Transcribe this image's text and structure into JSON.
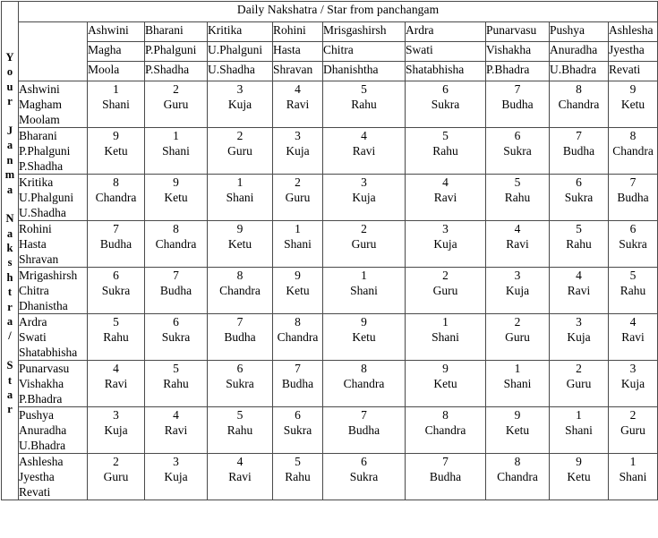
{
  "title": "Daily Nakshatra / Star from panchangam",
  "side_label": {
    "text": "Your Janma Nakshtra / Star",
    "letters": [
      "Y",
      "o",
      "u",
      "r",
      " ",
      "J",
      "a",
      "n",
      "m",
      "a",
      " ",
      "N",
      "a",
      "k",
      "s",
      "h",
      "t",
      "r",
      "a",
      "/",
      " ",
      "S",
      "t",
      "a",
      "r"
    ]
  },
  "column_headers": [
    {
      "line1": "Ashwini",
      "line2": "Magha",
      "line3": "Moola"
    },
    {
      "line1": "Bharani",
      "line2": "P.Phalguni",
      "line3": "P.Shadha"
    },
    {
      "line1": "Kritika",
      "line2": "U.Phalguni",
      "line3": "U.Shadha"
    },
    {
      "line1": "Rohini",
      "line2": "Hasta",
      "line3": "Shravan"
    },
    {
      "line1": "Mrisgashirsh",
      "line2": "Chitra",
      "line3": "Dhanishtha"
    },
    {
      "line1": "Ardra",
      "line2": "Swati",
      "line3": "Shatabhisha"
    },
    {
      "line1": "Punarvasu",
      "line2": "Vishakha",
      "line3": "P.Bhadra"
    },
    {
      "line1": "Pushya",
      "line2": "Anuradha",
      "line3": "U.Bhadra"
    },
    {
      "line1": "Ashlesha",
      "line2": "Jyestha",
      "line3": "Revati"
    }
  ],
  "row_headers": [
    {
      "line1": "Ashwini",
      "line2": "Magham",
      "line3": "Moolam"
    },
    {
      "line1": "Bharani",
      "line2": "P.Phalguni",
      "line3": "P.Shadha"
    },
    {
      "line1": "Kritika",
      "line2": "U.Phalguni",
      "line3": "U.Shadha"
    },
    {
      "line1": "Rohini",
      "line2": "Hasta",
      "line3": "Shravan"
    },
    {
      "line1": "Mrigashirsh",
      "line2": "Chitra",
      "line3": "Dhanistha"
    },
    {
      "line1": "Ardra",
      "line2": "Swati",
      "line3": "Shatabhisha"
    },
    {
      "line1": "Punarvasu",
      "line2": "Vishakha",
      "line3": "P.Bhadra"
    },
    {
      "line1": "Pushya",
      "line2": "Anuradha",
      "line3": "U.Bhadra"
    },
    {
      "line1": "Ashlesha",
      "line2": "Jyestha",
      "line3": "Revati"
    }
  ],
  "cells": [
    [
      {
        "num": "1",
        "planet": "Shani"
      },
      {
        "num": "2",
        "planet": "Guru"
      },
      {
        "num": "3",
        "planet": "Kuja"
      },
      {
        "num": "4",
        "planet": "Ravi"
      },
      {
        "num": "5",
        "planet": "Rahu"
      },
      {
        "num": "6",
        "planet": "Sukra"
      },
      {
        "num": "7",
        "planet": "Budha"
      },
      {
        "num": "8",
        "planet": "Chandra"
      },
      {
        "num": "9",
        "planet": "Ketu"
      }
    ],
    [
      {
        "num": "9",
        "planet": "Ketu"
      },
      {
        "num": "1",
        "planet": "Shani"
      },
      {
        "num": "2",
        "planet": "Guru"
      },
      {
        "num": "3",
        "planet": "Kuja"
      },
      {
        "num": "4",
        "planet": "Ravi"
      },
      {
        "num": "5",
        "planet": "Rahu"
      },
      {
        "num": "6",
        "planet": "Sukra"
      },
      {
        "num": "7",
        "planet": "Budha"
      },
      {
        "num": "8",
        "planet": "Chandra"
      }
    ],
    [
      {
        "num": "8",
        "planet": "Chandra"
      },
      {
        "num": "9",
        "planet": "Ketu"
      },
      {
        "num": "1",
        "planet": "Shani"
      },
      {
        "num": "2",
        "planet": "Guru"
      },
      {
        "num": "3",
        "planet": "Kuja"
      },
      {
        "num": "4",
        "planet": "Ravi"
      },
      {
        "num": "5",
        "planet": "Rahu"
      },
      {
        "num": "6",
        "planet": "Sukra"
      },
      {
        "num": "7",
        "planet": "Budha"
      }
    ],
    [
      {
        "num": "7",
        "planet": "Budha"
      },
      {
        "num": "8",
        "planet": "Chandra"
      },
      {
        "num": "9",
        "planet": "Ketu"
      },
      {
        "num": "1",
        "planet": "Shani"
      },
      {
        "num": "2",
        "planet": "Guru"
      },
      {
        "num": "3",
        "planet": "Kuja"
      },
      {
        "num": "4",
        "planet": "Ravi"
      },
      {
        "num": "5",
        "planet": "Rahu"
      },
      {
        "num": "6",
        "planet": "Sukra"
      }
    ],
    [
      {
        "num": "6",
        "planet": "Sukra"
      },
      {
        "num": "7",
        "planet": "Budha"
      },
      {
        "num": "8",
        "planet": "Chandra"
      },
      {
        "num": "9",
        "planet": "Ketu"
      },
      {
        "num": "1",
        "planet": "Shani"
      },
      {
        "num": "2",
        "planet": "Guru"
      },
      {
        "num": "3",
        "planet": "Kuja"
      },
      {
        "num": "4",
        "planet": "Ravi"
      },
      {
        "num": "5",
        "planet": "Rahu"
      }
    ],
    [
      {
        "num": "5",
        "planet": "Rahu"
      },
      {
        "num": "6",
        "planet": "Sukra"
      },
      {
        "num": "7",
        "planet": "Budha"
      },
      {
        "num": "8",
        "planet": "Chandra"
      },
      {
        "num": "9",
        "planet": "Ketu"
      },
      {
        "num": "1",
        "planet": "Shani"
      },
      {
        "num": "2",
        "planet": "Guru"
      },
      {
        "num": "3",
        "planet": "Kuja"
      },
      {
        "num": "4",
        "planet": "Ravi"
      }
    ],
    [
      {
        "num": "4",
        "planet": "Ravi"
      },
      {
        "num": "5",
        "planet": "Rahu"
      },
      {
        "num": "6",
        "planet": "Sukra"
      },
      {
        "num": "7",
        "planet": "Budha"
      },
      {
        "num": "8",
        "planet": "Chandra"
      },
      {
        "num": "9",
        "planet": "Ketu"
      },
      {
        "num": "1",
        "planet": "Shani"
      },
      {
        "num": "2",
        "planet": "Guru"
      },
      {
        "num": "3",
        "planet": "Kuja"
      }
    ],
    [
      {
        "num": "3",
        "planet": "Kuja"
      },
      {
        "num": "4",
        "planet": "Ravi"
      },
      {
        "num": "5",
        "planet": "Rahu"
      },
      {
        "num": "6",
        "planet": "Sukra"
      },
      {
        "num": "7",
        "planet": "Budha"
      },
      {
        "num": "8",
        "planet": "Chandra"
      },
      {
        "num": "9",
        "planet": "Ketu"
      },
      {
        "num": "1",
        "planet": "Shani"
      },
      {
        "num": "2",
        "planet": "Guru"
      }
    ],
    [
      {
        "num": "2",
        "planet": "Guru"
      },
      {
        "num": "3",
        "planet": "Kuja"
      },
      {
        "num": "4",
        "planet": "Ravi"
      },
      {
        "num": "5",
        "planet": "Rahu"
      },
      {
        "num": "6",
        "planet": "Sukra"
      },
      {
        "num": "7",
        "planet": "Budha"
      },
      {
        "num": "8",
        "planet": "Chandra"
      },
      {
        "num": "9",
        "planet": "Ketu"
      },
      {
        "num": "1",
        "planet": "Shani"
      }
    ]
  ],
  "colors": {
    "border": "#4a4a4a",
    "text": "#000000",
    "background": "#ffffff"
  }
}
